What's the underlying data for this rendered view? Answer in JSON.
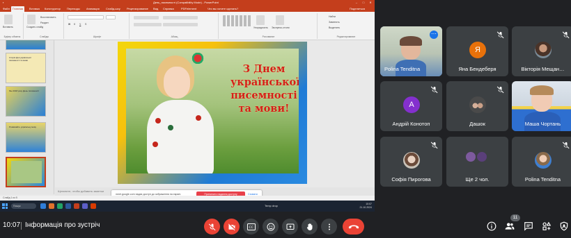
{
  "powerpoint": {
    "window_title": "День_писемності (Compatibility Mode) - PowerPoint",
    "tabs": [
      "Файл",
      "Главная",
      "Вставка",
      "Конструктор",
      "Переходы",
      "Анимация",
      "Слайд-шоу",
      "Рецензирование",
      "Вид",
      "Справка",
      "PDFelement",
      "Что вы хотите сделать?"
    ],
    "share_label": "Поделиться",
    "ribbon": {
      "paste": "Вставить",
      "new_slide": "Создать слайд",
      "reuse": "Восстановить",
      "section": "Раздел",
      "groups": [
        "Буфер обмена",
        "Слайды",
        "Шрифт",
        "Абзац",
        "Рисование",
        "Редактирование"
      ],
      "arrange": "Упорядочить",
      "quick_styles": "Экспресс-стили",
      "find": "Найти",
      "replace": "Заменить",
      "select": "Выделить"
    },
    "thumbnails": [
      {
        "num": "",
        "text": ""
      },
      {
        "num": "",
        "text": "Історія Дня української писемності та мови"
      },
      {
        "num": "",
        "text": "Мы 2018 року День писемності"
      },
      {
        "num": "",
        "text": "Розвивайте українську мову"
      },
      {
        "num": "",
        "text": ""
      }
    ],
    "slide_text": [
      "З Днем",
      "української",
      "писемності",
      "та мови!"
    ],
    "notes_placeholder": "Щелкните, чтобы добавить заметки",
    "status_left": "Слайд 1 из 5",
    "sharing_toast": {
      "message": "meet.google.com надає доступ до зображення на екрані.",
      "stop_label": "Припинити надання доступу",
      "hide_label": "Сховати"
    },
    "taskbar": {
      "search_placeholder": "Пошук",
      "weather": "Temp drop",
      "tray_time": "10:07",
      "tray_date": "21.10.2024"
    }
  },
  "participants": [
    {
      "name": "Polina Tenditna",
      "avatar_letter": "",
      "avatar_color": "",
      "muted": false,
      "speaking": true
    },
    {
      "name": "Яна Бендеберя",
      "avatar_letter": "Я",
      "avatar_color": "#e8710a",
      "muted": true
    },
    {
      "name": "Вікторія Мещан…",
      "avatar_letter": "",
      "avatar_color": "",
      "muted": true
    },
    {
      "name": "Андрій Конотоп",
      "avatar_letter": "А",
      "avatar_color": "#8430ce",
      "muted": true
    },
    {
      "name": "Дашок",
      "avatar_letter": "",
      "avatar_color": "",
      "muted": true
    },
    {
      "name": "Маша Чортань",
      "avatar_letter": "",
      "avatar_color": "",
      "muted": true
    },
    {
      "name": "Софія Пирогова",
      "avatar_letter": "",
      "avatar_color": "",
      "muted": true
    },
    {
      "name": "Ще 2 чол.",
      "avatar_letter": "",
      "avatar_color": "",
      "muted": false
    },
    {
      "name": "Polina Tenditna",
      "avatar_letter": "",
      "avatar_color": "",
      "muted": true
    }
  ],
  "meet": {
    "time": "10:07",
    "meeting_info": "Інформація про зустріч",
    "participant_count": "11"
  },
  "colors": {
    "meet_bg": "#202124",
    "tile_bg": "#3c4043",
    "danger": "#ea4335",
    "ppt_accent": "#c43e1c"
  }
}
